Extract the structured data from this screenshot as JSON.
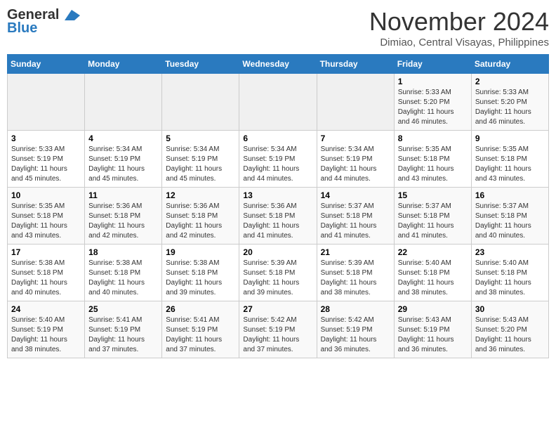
{
  "header": {
    "logo_line1": "General",
    "logo_line2": "Blue",
    "month": "November 2024",
    "location": "Dimiao, Central Visayas, Philippines"
  },
  "weekdays": [
    "Sunday",
    "Monday",
    "Tuesday",
    "Wednesday",
    "Thursday",
    "Friday",
    "Saturday"
  ],
  "weeks": [
    [
      {
        "day": "",
        "sunrise": "",
        "sunset": "",
        "daylight": "",
        "empty": true
      },
      {
        "day": "",
        "sunrise": "",
        "sunset": "",
        "daylight": "",
        "empty": true
      },
      {
        "day": "",
        "sunrise": "",
        "sunset": "",
        "daylight": "",
        "empty": true
      },
      {
        "day": "",
        "sunrise": "",
        "sunset": "",
        "daylight": "",
        "empty": true
      },
      {
        "day": "",
        "sunrise": "",
        "sunset": "",
        "daylight": "",
        "empty": true
      },
      {
        "day": "1",
        "sunrise": "Sunrise: 5:33 AM",
        "sunset": "Sunset: 5:20 PM",
        "daylight": "Daylight: 11 hours and 46 minutes.",
        "empty": false
      },
      {
        "day": "2",
        "sunrise": "Sunrise: 5:33 AM",
        "sunset": "Sunset: 5:20 PM",
        "daylight": "Daylight: 11 hours and 46 minutes.",
        "empty": false
      }
    ],
    [
      {
        "day": "3",
        "sunrise": "Sunrise: 5:33 AM",
        "sunset": "Sunset: 5:19 PM",
        "daylight": "Daylight: 11 hours and 45 minutes.",
        "empty": false
      },
      {
        "day": "4",
        "sunrise": "Sunrise: 5:34 AM",
        "sunset": "Sunset: 5:19 PM",
        "daylight": "Daylight: 11 hours and 45 minutes.",
        "empty": false
      },
      {
        "day": "5",
        "sunrise": "Sunrise: 5:34 AM",
        "sunset": "Sunset: 5:19 PM",
        "daylight": "Daylight: 11 hours and 45 minutes.",
        "empty": false
      },
      {
        "day": "6",
        "sunrise": "Sunrise: 5:34 AM",
        "sunset": "Sunset: 5:19 PM",
        "daylight": "Daylight: 11 hours and 44 minutes.",
        "empty": false
      },
      {
        "day": "7",
        "sunrise": "Sunrise: 5:34 AM",
        "sunset": "Sunset: 5:19 PM",
        "daylight": "Daylight: 11 hours and 44 minutes.",
        "empty": false
      },
      {
        "day": "8",
        "sunrise": "Sunrise: 5:35 AM",
        "sunset": "Sunset: 5:18 PM",
        "daylight": "Daylight: 11 hours and 43 minutes.",
        "empty": false
      },
      {
        "day": "9",
        "sunrise": "Sunrise: 5:35 AM",
        "sunset": "Sunset: 5:18 PM",
        "daylight": "Daylight: 11 hours and 43 minutes.",
        "empty": false
      }
    ],
    [
      {
        "day": "10",
        "sunrise": "Sunrise: 5:35 AM",
        "sunset": "Sunset: 5:18 PM",
        "daylight": "Daylight: 11 hours and 43 minutes.",
        "empty": false
      },
      {
        "day": "11",
        "sunrise": "Sunrise: 5:36 AM",
        "sunset": "Sunset: 5:18 PM",
        "daylight": "Daylight: 11 hours and 42 minutes.",
        "empty": false
      },
      {
        "day": "12",
        "sunrise": "Sunrise: 5:36 AM",
        "sunset": "Sunset: 5:18 PM",
        "daylight": "Daylight: 11 hours and 42 minutes.",
        "empty": false
      },
      {
        "day": "13",
        "sunrise": "Sunrise: 5:36 AM",
        "sunset": "Sunset: 5:18 PM",
        "daylight": "Daylight: 11 hours and 41 minutes.",
        "empty": false
      },
      {
        "day": "14",
        "sunrise": "Sunrise: 5:37 AM",
        "sunset": "Sunset: 5:18 PM",
        "daylight": "Daylight: 11 hours and 41 minutes.",
        "empty": false
      },
      {
        "day": "15",
        "sunrise": "Sunrise: 5:37 AM",
        "sunset": "Sunset: 5:18 PM",
        "daylight": "Daylight: 11 hours and 41 minutes.",
        "empty": false
      },
      {
        "day": "16",
        "sunrise": "Sunrise: 5:37 AM",
        "sunset": "Sunset: 5:18 PM",
        "daylight": "Daylight: 11 hours and 40 minutes.",
        "empty": false
      }
    ],
    [
      {
        "day": "17",
        "sunrise": "Sunrise: 5:38 AM",
        "sunset": "Sunset: 5:18 PM",
        "daylight": "Daylight: 11 hours and 40 minutes.",
        "empty": false
      },
      {
        "day": "18",
        "sunrise": "Sunrise: 5:38 AM",
        "sunset": "Sunset: 5:18 PM",
        "daylight": "Daylight: 11 hours and 40 minutes.",
        "empty": false
      },
      {
        "day": "19",
        "sunrise": "Sunrise: 5:38 AM",
        "sunset": "Sunset: 5:18 PM",
        "daylight": "Daylight: 11 hours and 39 minutes.",
        "empty": false
      },
      {
        "day": "20",
        "sunrise": "Sunrise: 5:39 AM",
        "sunset": "Sunset: 5:18 PM",
        "daylight": "Daylight: 11 hours and 39 minutes.",
        "empty": false
      },
      {
        "day": "21",
        "sunrise": "Sunrise: 5:39 AM",
        "sunset": "Sunset: 5:18 PM",
        "daylight": "Daylight: 11 hours and 38 minutes.",
        "empty": false
      },
      {
        "day": "22",
        "sunrise": "Sunrise: 5:40 AM",
        "sunset": "Sunset: 5:18 PM",
        "daylight": "Daylight: 11 hours and 38 minutes.",
        "empty": false
      },
      {
        "day": "23",
        "sunrise": "Sunrise: 5:40 AM",
        "sunset": "Sunset: 5:18 PM",
        "daylight": "Daylight: 11 hours and 38 minutes.",
        "empty": false
      }
    ],
    [
      {
        "day": "24",
        "sunrise": "Sunrise: 5:40 AM",
        "sunset": "Sunset: 5:19 PM",
        "daylight": "Daylight: 11 hours and 38 minutes.",
        "empty": false
      },
      {
        "day": "25",
        "sunrise": "Sunrise: 5:41 AM",
        "sunset": "Sunset: 5:19 PM",
        "daylight": "Daylight: 11 hours and 37 minutes.",
        "empty": false
      },
      {
        "day": "26",
        "sunrise": "Sunrise: 5:41 AM",
        "sunset": "Sunset: 5:19 PM",
        "daylight": "Daylight: 11 hours and 37 minutes.",
        "empty": false
      },
      {
        "day": "27",
        "sunrise": "Sunrise: 5:42 AM",
        "sunset": "Sunset: 5:19 PM",
        "daylight": "Daylight: 11 hours and 37 minutes.",
        "empty": false
      },
      {
        "day": "28",
        "sunrise": "Sunrise: 5:42 AM",
        "sunset": "Sunset: 5:19 PM",
        "daylight": "Daylight: 11 hours and 36 minutes.",
        "empty": false
      },
      {
        "day": "29",
        "sunrise": "Sunrise: 5:43 AM",
        "sunset": "Sunset: 5:19 PM",
        "daylight": "Daylight: 11 hours and 36 minutes.",
        "empty": false
      },
      {
        "day": "30",
        "sunrise": "Sunrise: 5:43 AM",
        "sunset": "Sunset: 5:20 PM",
        "daylight": "Daylight: 11 hours and 36 minutes.",
        "empty": false
      }
    ]
  ]
}
